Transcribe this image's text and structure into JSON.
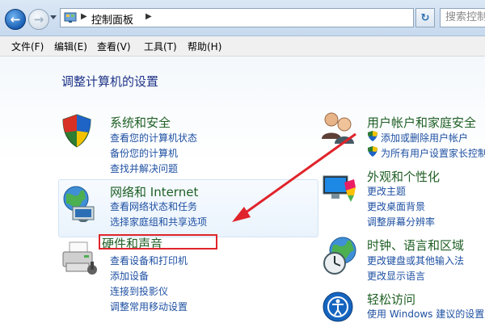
{
  "address": {
    "breadcrumb": "控制面板",
    "search_placeholder": "搜索控制"
  },
  "menu": [
    "文件(F)",
    "编辑(E)",
    "查看(V)",
    "工具(T)",
    "帮助(H)"
  ],
  "page_title": "调整计算机的设置",
  "left": {
    "system": {
      "title": "系统和安全",
      "links": [
        "查看您的计算机状态",
        "备份您的计算机",
        "查找并解决问题"
      ]
    },
    "network": {
      "title": "网络和 Internet",
      "links": [
        "查看网络状态和任务",
        "选择家庭组和共享选项"
      ]
    },
    "hardware": {
      "title": "硬件和声音",
      "links": [
        "查看设备和打印机",
        "添加设备",
        "连接到投影仪",
        "调整常用移动设置"
      ]
    }
  },
  "right": {
    "users": {
      "title": "用户帐户和家庭安全",
      "links": [
        "添加或删除用户帐户",
        "为所有用户设置家长控制"
      ]
    },
    "appearance": {
      "title": "外观和个性化",
      "links": [
        "更改主题",
        "更改桌面背景",
        "调整屏幕分辨率"
      ]
    },
    "clock": {
      "title": "时钟、语言和区域",
      "links": [
        "更改键盘或其他输入法",
        "更改显示语言"
      ]
    },
    "ease": {
      "title": "轻松访问",
      "links": [
        "使用 Windows 建议的设置"
      ]
    }
  },
  "annotation_color": "#e0242b",
  "icons": [
    "shield-icon",
    "network-globe-icon",
    "printer-icon",
    "users-icon",
    "display-paint-icon",
    "clock-globe-icon",
    "ease-access-icon",
    "uac-shield-icon",
    "control-panel-icon",
    "refresh-icon"
  ]
}
